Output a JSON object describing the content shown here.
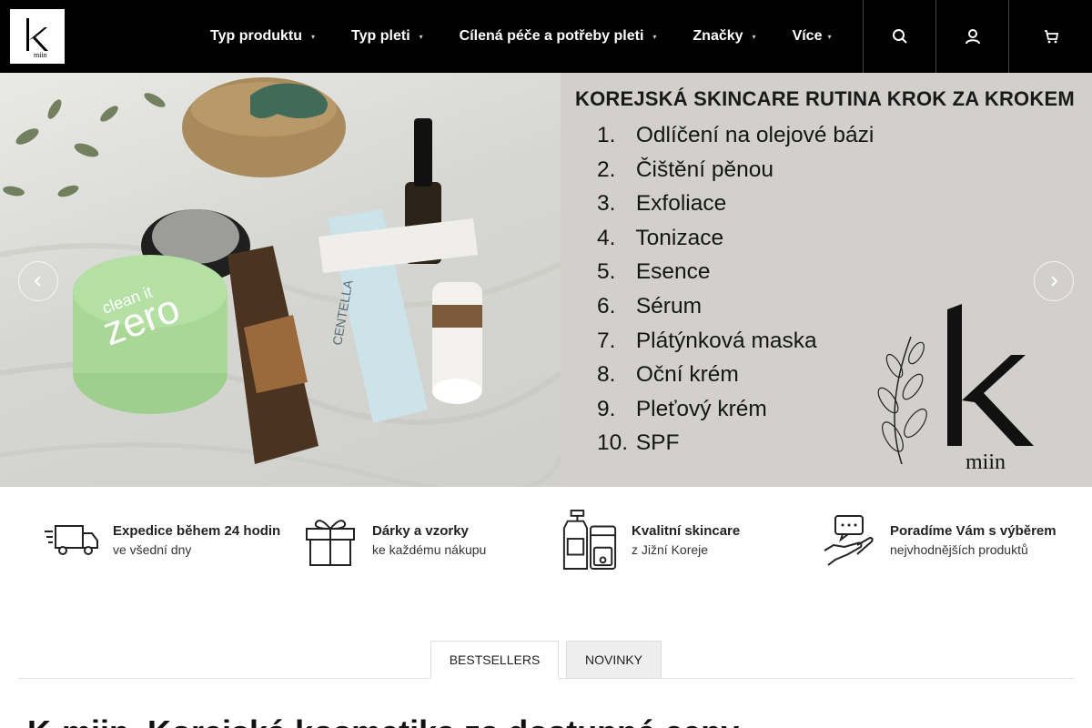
{
  "header": {
    "logo_letter": "k",
    "logo_word": "miin",
    "nav": [
      {
        "label": "Typ produktu",
        "caret": "▾"
      },
      {
        "label": "Typ pleti",
        "caret": "▾"
      },
      {
        "label": "Cílená péče a potřeby pleti",
        "caret": "▾"
      },
      {
        "label": "Značky",
        "caret": "▾"
      },
      {
        "label": "Více",
        "caret": "▾"
      }
    ],
    "icons": [
      "search-icon",
      "user-icon",
      "cart-icon"
    ]
  },
  "hero": {
    "title": "KOREJSKÁ SKINCARE RUTINA KROK ZA KROKEM",
    "steps": [
      {
        "num": "1.",
        "text": "Odlíčení na olejové bázi"
      },
      {
        "num": "2.",
        "text": "Čištění pěnou"
      },
      {
        "num": "3.",
        "text": "Exfoliace"
      },
      {
        "num": "4.",
        "text": "Tonizace"
      },
      {
        "num": "5.",
        "text": "Esence"
      },
      {
        "num": "6.",
        "text": "Sérum"
      },
      {
        "num": "7.",
        "text": "Plátýnková maska"
      },
      {
        "num": "8.",
        "text": "Oční krém"
      },
      {
        "num": "9.",
        "text": "Pleťový krém"
      },
      {
        "num": "10.",
        "text": "SPF"
      }
    ],
    "jar_text_1": "clean it",
    "jar_text_2": "zero",
    "tube_text": "CENTELLA",
    "panel_logo_letter": "k",
    "panel_logo_word": "miin",
    "prev_icon": "chevron-left-icon",
    "next_icon": "chevron-right-icon"
  },
  "benefits": [
    {
      "icon": "truck-icon",
      "title": "Expedice během 24 hodin",
      "subtitle": "ve všední dny"
    },
    {
      "icon": "gift-icon",
      "title": "Dárky a vzorky",
      "subtitle": "ke každému nákupu"
    },
    {
      "icon": "cosmetics-icon",
      "title": "Kvalitní skincare",
      "subtitle": "z Jižní Koreje"
    },
    {
      "icon": "advice-hand-icon",
      "title": "Poradíme Vám s výběrem",
      "subtitle": "nejvhodnějších produktů"
    }
  ],
  "tabs": [
    {
      "label": "BESTSELLERS",
      "active": true
    },
    {
      "label": "NOVINKY",
      "active": false
    }
  ],
  "bottom_heading": "K-miin. Korejská kosmetika za dostupné ceny"
}
